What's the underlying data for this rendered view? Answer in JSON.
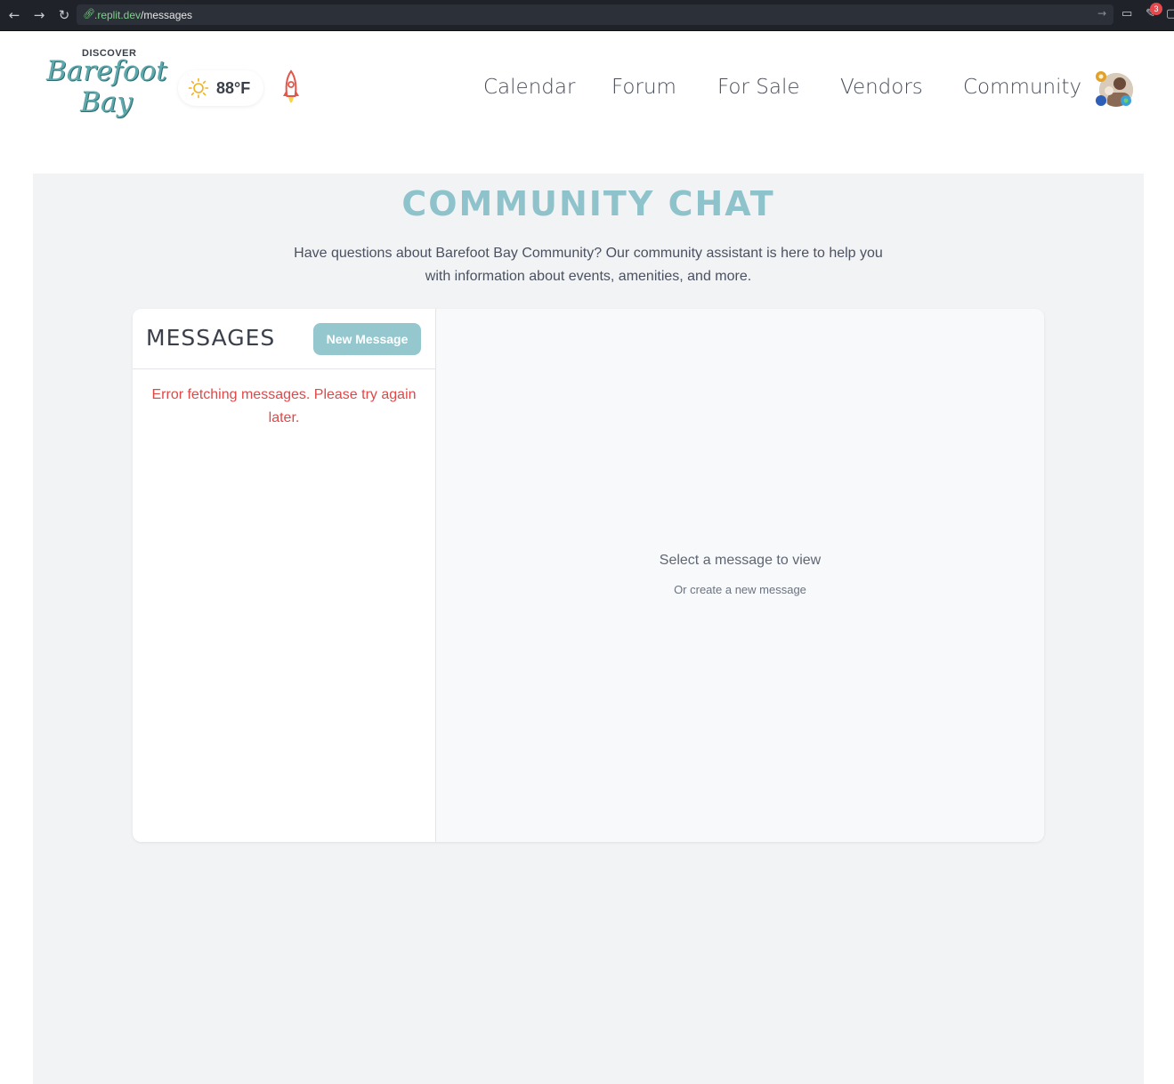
{
  "browser": {
    "url_domain": ".replit.dev",
    "url_path": "/messages",
    "badge_count": "3"
  },
  "header": {
    "logo_top": "DISCOVER",
    "logo_line1": "Barefoot",
    "logo_line2": "Bay",
    "weather_temp": "88°F",
    "nav": [
      "Calendar",
      "Forum",
      "For Sale",
      "Vendors",
      "Community"
    ]
  },
  "main": {
    "title": "COMMUNITY CHAT",
    "subtitle_line1": "Have questions about Barefoot Bay Community? Our community assistant is here to help you",
    "subtitle_line2": "with information about events, amenities, and more.",
    "messages_title": "MESSAGES",
    "new_message_label": "New Message",
    "error_text": "Error fetching messages. Please try again later.",
    "empty_title": "Select a message to view",
    "empty_subtitle": "Or create a new message"
  },
  "colors": {
    "accent": "#95c7cf",
    "title": "#8fc3cc",
    "error": "#e04848",
    "background": "#f2f3f5"
  }
}
